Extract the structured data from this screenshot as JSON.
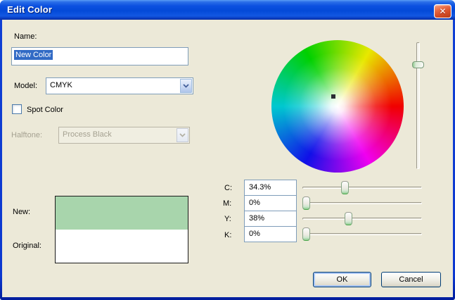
{
  "window": {
    "title": "Edit Color"
  },
  "icons": {
    "close": "✕"
  },
  "fields": {
    "name": {
      "label": "Name:",
      "value": "New Color",
      "selected": true
    },
    "model": {
      "label": "Model:",
      "value": "CMYK"
    },
    "spot_color": {
      "label": "Spot Color",
      "checked": false
    },
    "halftone": {
      "label": "Halftone:",
      "value": "Process Black",
      "enabled": false
    }
  },
  "preview": {
    "new_label": "New:",
    "original_label": "Original:",
    "new_color": "#a8d5ac",
    "original_color": "#ffffff"
  },
  "color_wheel": {
    "marker_x_percent": 46.8,
    "marker_y_percent": 42.6,
    "brightness_percent_from_top": 16
  },
  "cmyk": {
    "channels": [
      {
        "label": "C:",
        "value": "34.3%",
        "percent": 34.3
      },
      {
        "label": "M:",
        "value": "0%",
        "percent": 0
      },
      {
        "label": "Y:",
        "value": "38%",
        "percent": 38
      },
      {
        "label": "K:",
        "value": "0%",
        "percent": 0
      }
    ]
  },
  "buttons": {
    "ok": "OK",
    "cancel": "Cancel"
  },
  "colors": {
    "dialog_background": "#ece9d8",
    "title_bar_blue": "#0c50e0",
    "selection_blue": "#316ac5",
    "input_border": "#7f9db9"
  }
}
